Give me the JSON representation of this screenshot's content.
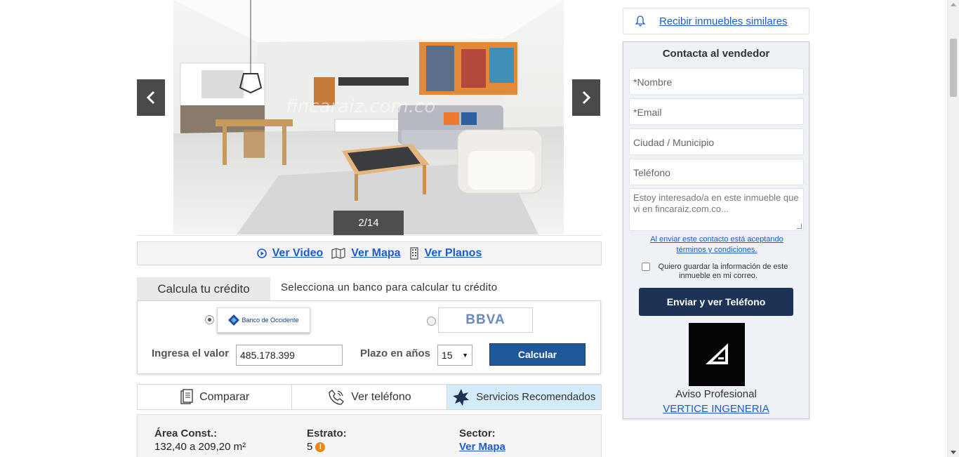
{
  "gallery": {
    "counter": "2/14",
    "watermark": "fincaraiz.com.co",
    "prev_icon": "chevron-left-icon",
    "next_icon": "chevron-right-icon"
  },
  "media_links": {
    "video": "Ver Video",
    "map": "Ver Mapa",
    "plans": "Ver Planos"
  },
  "credit": {
    "tab_title": "Calcula tu crédito",
    "subtitle": "Selecciona un banco para calcular tu crédito",
    "banks": [
      {
        "name": "Banco de Occidente",
        "selected": true
      },
      {
        "name": "BBVA",
        "selected": false
      }
    ],
    "value_label": "Ingresa el valor",
    "value": "485.178.399",
    "years_label": "Plazo en años",
    "years_value": "15",
    "calc_button": "Calcular"
  },
  "actions": {
    "compare": "Comparar",
    "phone": "Ver teléfono",
    "services": "Servicios Recomendados"
  },
  "details": {
    "area_label": "Área Const.:",
    "area_value": "132,40 a 209,20 m²",
    "estrato_label": "Estrato:",
    "estrato_value": "5",
    "sector_label": "Sector:",
    "sector_value": "Ver Mapa"
  },
  "sidebar": {
    "similar_link": "Recibir inmuebles similares",
    "contact_title": "Contacta al vendedor",
    "name_placeholder": "*Nombre",
    "email_placeholder": "*Email",
    "city_placeholder": "Ciudad / Municipio",
    "phone_placeholder": "Teléfono",
    "message_placeholder": "Estoy interesado/a en este inmueble que vi en fincaraiz.com.co...",
    "terms": "Al enviar este contacto está aceptando términos y condiciones.",
    "save_info": "Quiero guardar la información de este inmueble en mi correo.",
    "send_button": "Enviar y ver Teléfono",
    "agent_type": "Aviso Profesional",
    "agent_name": "VERTICE INGENERIA"
  },
  "colors": {
    "link": "#1b5bd6",
    "calc_button": "#1f5799",
    "send_button": "#1c3356",
    "services_tab": "#d3ecfa"
  }
}
